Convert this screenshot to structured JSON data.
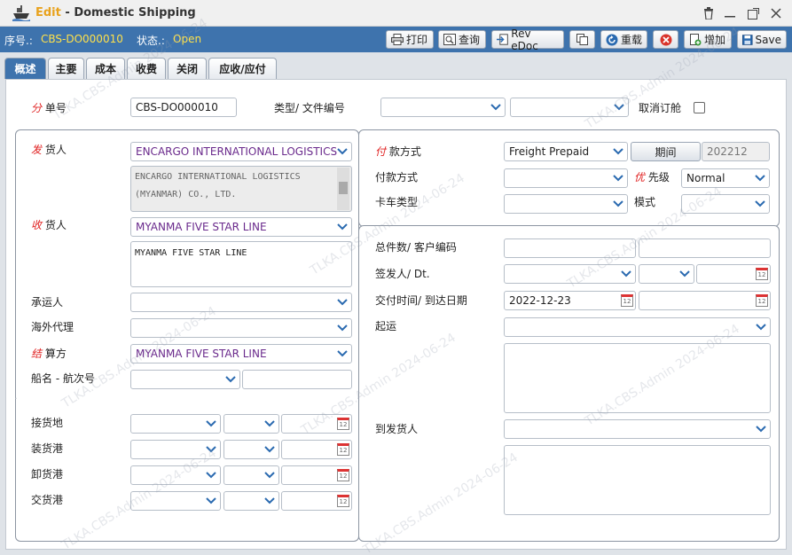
{
  "window": {
    "edit_label": "Edit",
    "separator": " - ",
    "title": "Domestic Shipping"
  },
  "status": {
    "seq_label": "序号.:",
    "seq_value": "CBS-DO000010",
    "state_label": "状态.:",
    "state_value": "Open"
  },
  "toolbar": {
    "print": "打印",
    "query": "查询",
    "rev_edoc": "Rev eDoc",
    "reload": "重载",
    "add": "增加",
    "save": "Save"
  },
  "tabs": [
    "概述",
    "主要",
    "成本",
    "收费",
    "关闭",
    "应收/应付"
  ],
  "top": {
    "doc_no_label_r": "分",
    "doc_no_label": " 单号",
    "doc_no": "CBS-DO000010",
    "type_label": "类型/ 文件编号",
    "type_value": "",
    "file_no": "",
    "cancel_label": "取消订舱"
  },
  "left": {
    "shipper_label_r": "发",
    "shipper_label": " 货人",
    "shipper": "ENCARGO INTERNATIONAL LOGISTICS",
    "shipper_address": "ENCARGO INTERNATIONAL LOGISTICS\n(MYANMAR) CO., LTD.",
    "consignee_label_r": "收",
    "consignee_label": " 货人",
    "consignee": "MYANMA FIVE STAR LINE",
    "consignee_address": "MYANMA FIVE STAR LINE",
    "carrier_label": "承运人",
    "carrier": "",
    "agent_label": "海外代理",
    "agent": "",
    "settle_label_r": "结",
    "settle_label": " 算方",
    "settle": "MYANMA FIVE STAR LINE",
    "vessel_label": "船名 - 航次号",
    "vessel": "",
    "voyage": ""
  },
  "ports": {
    "receipt_label": "接货地",
    "loading_label": "装货港",
    "discharge_label": "卸货港",
    "delivery_label": "交货港"
  },
  "right": {
    "pay_label_r": "付",
    "pay_label": " 款方式",
    "pay": "Freight Prepaid",
    "period_button": "期间",
    "period_value": "202212",
    "pay2_label": "付款方式",
    "pay2": "",
    "priority_label_r": "优",
    "priority_label": " 先级",
    "priority": "Normal",
    "truck_label": "卡车类型",
    "truck": "",
    "mode_label": "模式",
    "mode": "",
    "pieces_label": "总件数/ 客户编码",
    "pieces": "",
    "customer_code": "",
    "issuer_label": "签发人/  Dt.",
    "issuer": "",
    "issuer2": "",
    "issue_date": "",
    "delivery_label": "交付时间/ 到达日期",
    "delivery_date": "2022-12-23",
    "arrival_date": "",
    "origin_label": "起运",
    "origin": "",
    "destination_label": "到发货人",
    "destination": ""
  },
  "watermark": "TLKA.CBS.Admin 2024-06-24",
  "colors": {
    "accent": "#3e73ad",
    "status_value": "#ffe14a",
    "required": "#e02020",
    "party_text": "#6a2a8c"
  }
}
